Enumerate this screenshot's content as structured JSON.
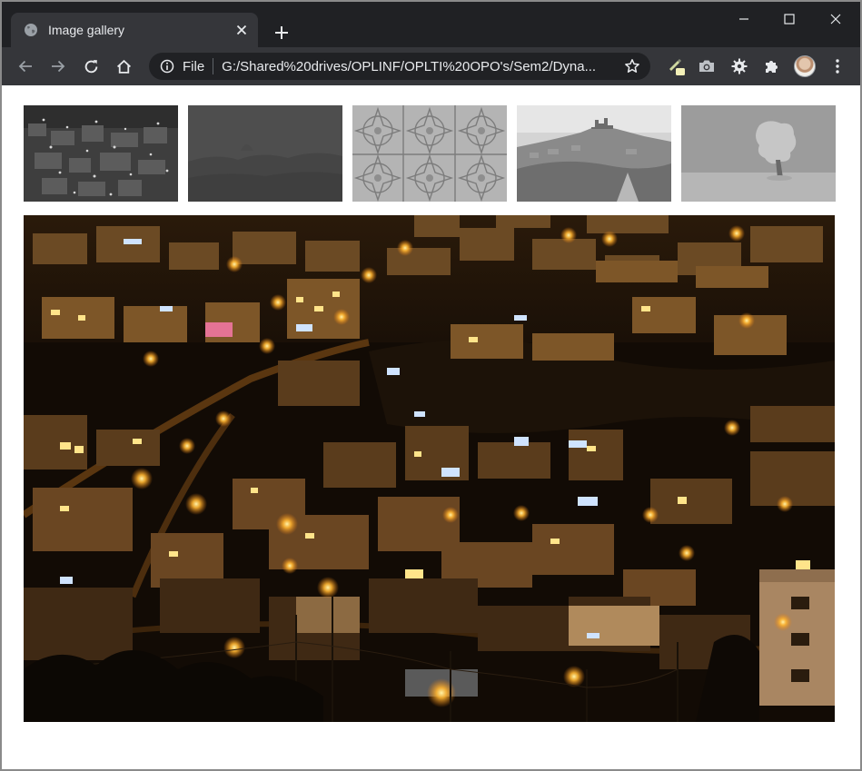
{
  "browser": {
    "tab": {
      "title": "Image gallery",
      "favicon": "globe-icon"
    },
    "new_tab_icon": "plus-icon",
    "window_controls": [
      "minimize-icon",
      "maximize-icon",
      "close-icon"
    ],
    "toolbar": {
      "back_icon": "arrow-left-icon",
      "forward_icon": "arrow-right-icon",
      "reload_icon": "reload-icon",
      "home_icon": "home-icon",
      "address": {
        "scheme_label": "File",
        "url": "G:/Shared%20drives/OPLINF/OPLTI%20OPO's/Sem2/Dyna..."
      },
      "bookmark_icon": "star-icon",
      "extensions": [
        "highlighter-extension-icon",
        "camera-extension-icon",
        "gear-extension-icon",
        "puzzle-extensions-icon"
      ],
      "profile_icon": "avatar",
      "menu_icon": "kebab-menu-icon"
    },
    "colors": {
      "tabstrip": "#202124",
      "toolbar": "#35363a",
      "text": "#e8eaed"
    }
  },
  "gallery": {
    "thumbnails": [
      {
        "name": "night-city-thumbnail",
        "style": "grayscale"
      },
      {
        "name": "dark-landscape-thumbnail",
        "style": "grayscale"
      },
      {
        "name": "geometric-pattern-thumbnail",
        "style": "grayscale"
      },
      {
        "name": "hilltop-castle-thumbnail",
        "style": "grayscale"
      },
      {
        "name": "snowy-tree-thumbnail",
        "style": "grayscale"
      }
    ],
    "main_image": {
      "name": "night-city-main-image",
      "style": "color"
    }
  }
}
